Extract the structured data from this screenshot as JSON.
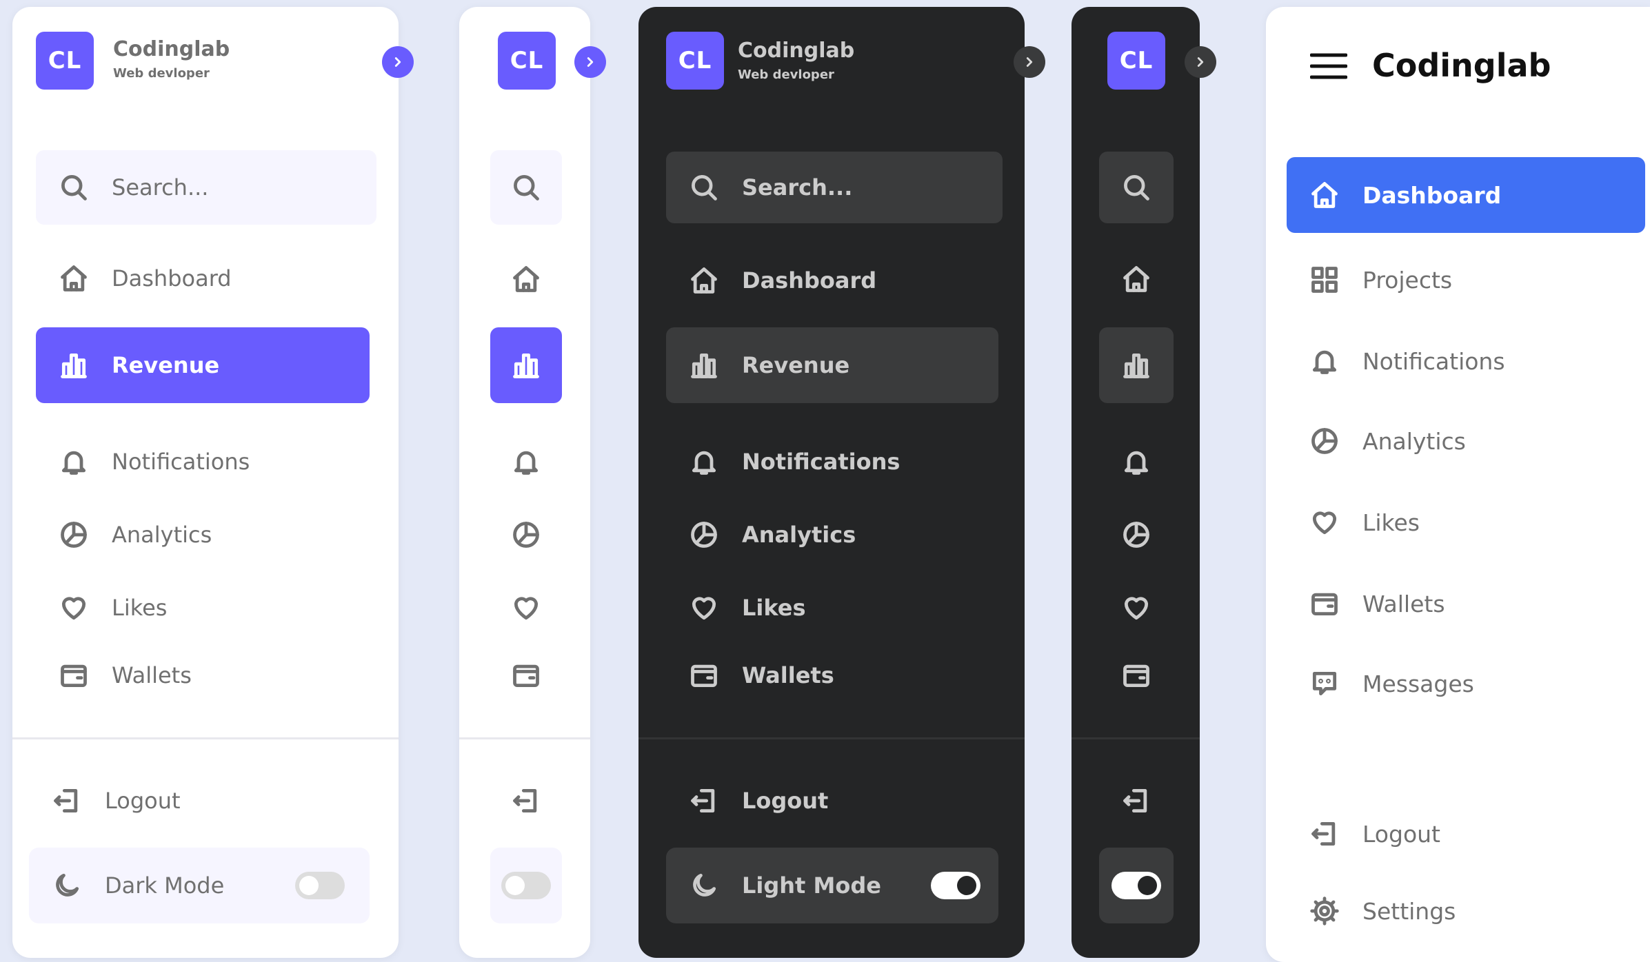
{
  "brand": {
    "logo_text": "CL",
    "name": "Codinglab",
    "subtitle": "Web devloper"
  },
  "search": {
    "placeholder": "Search..."
  },
  "menu": {
    "dashboard": "Dashboard",
    "revenue": "Revenue",
    "notifications": "Notifications",
    "analytics": "Analytics",
    "likes": "Likes",
    "wallets": "Wallets"
  },
  "bottom": {
    "logout": "Logout",
    "dark_mode": "Dark Mode",
    "light_mode": "Light Mode"
  },
  "nav2": {
    "title": "Codinglab",
    "items": [
      "Dashboard",
      "Projects",
      "Notifications",
      "Analytics",
      "Likes",
      "Wallets",
      "Messages"
    ],
    "logout": "Logout",
    "settings": "Settings"
  },
  "colors": {
    "page_bg": "#e4e9f7",
    "primary": "#695cfe",
    "dark_bg": "#242526",
    "dark_item": "#3a3b3c",
    "blue_active": "#4070f4",
    "text_light": "#707070",
    "text_dark": "#cccccc"
  }
}
